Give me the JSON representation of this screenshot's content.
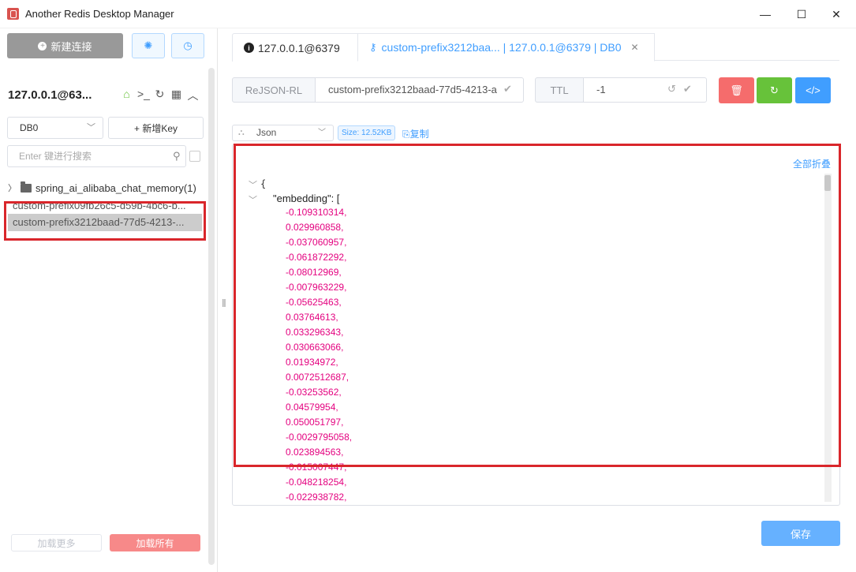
{
  "window": {
    "title": "Another Redis Desktop Manager",
    "minimize": "—",
    "maximize": "☐",
    "close": "✕"
  },
  "left": {
    "new_connection_label": "新建连接",
    "connection_name": "127.0.0.1@63...",
    "db_select": "DB0",
    "add_key_label": "+ 新增Key",
    "search_placeholder": "Enter 键进行搜索",
    "folder": {
      "name": "spring_ai_alibaba_chat_memory",
      "count": "(1)"
    },
    "keys": [
      {
        "label": "custom-prefix09fb26c5-d59b-4bc6-b..."
      },
      {
        "label": "custom-prefix3212baad-77d5-4213-..."
      }
    ],
    "load_more_label": "加载更多",
    "load_all_label": "加载所有"
  },
  "tabs": [
    {
      "label": "127.0.0.1@6379"
    },
    {
      "label": "custom-prefix3212baa... | 127.0.0.1@6379 | DB0"
    }
  ],
  "key_detail": {
    "type": "ReJSON-RL",
    "key_name": "custom-prefix3212baad-77d5-4213-a",
    "ttl_label": "TTL",
    "ttl_value": "-1"
  },
  "viewer": {
    "format": "Json",
    "size": "Size: 12.52KB",
    "copy_label": "复制",
    "collapse_all_label": "全部折叠",
    "open_brace": "{",
    "field_key": "\"embedding\"",
    "field_suffix": ": [",
    "values": [
      "-0.109310314,",
      "0.029960858,",
      "-0.037060957,",
      "-0.061872292,",
      "-0.08012969,",
      "-0.007963229,",
      "-0.05625463,",
      "0.03764613,",
      "0.033296343,",
      "0.030663066,",
      "0.01934972,",
      "0.0072512687,",
      "-0.03253562,",
      "0.04579954,",
      "0.050051797,",
      "-0.0029795058,",
      "0.023894563,",
      "-0.015007447,",
      "-0.048218254,",
      "-0.022938782,"
    ]
  },
  "save_label": "保存",
  "colors": {
    "accent": "#409eff",
    "danger": "#f56c6c",
    "success": "#67c23a",
    "number": "#e4007f",
    "highlight": "#d9262b"
  }
}
